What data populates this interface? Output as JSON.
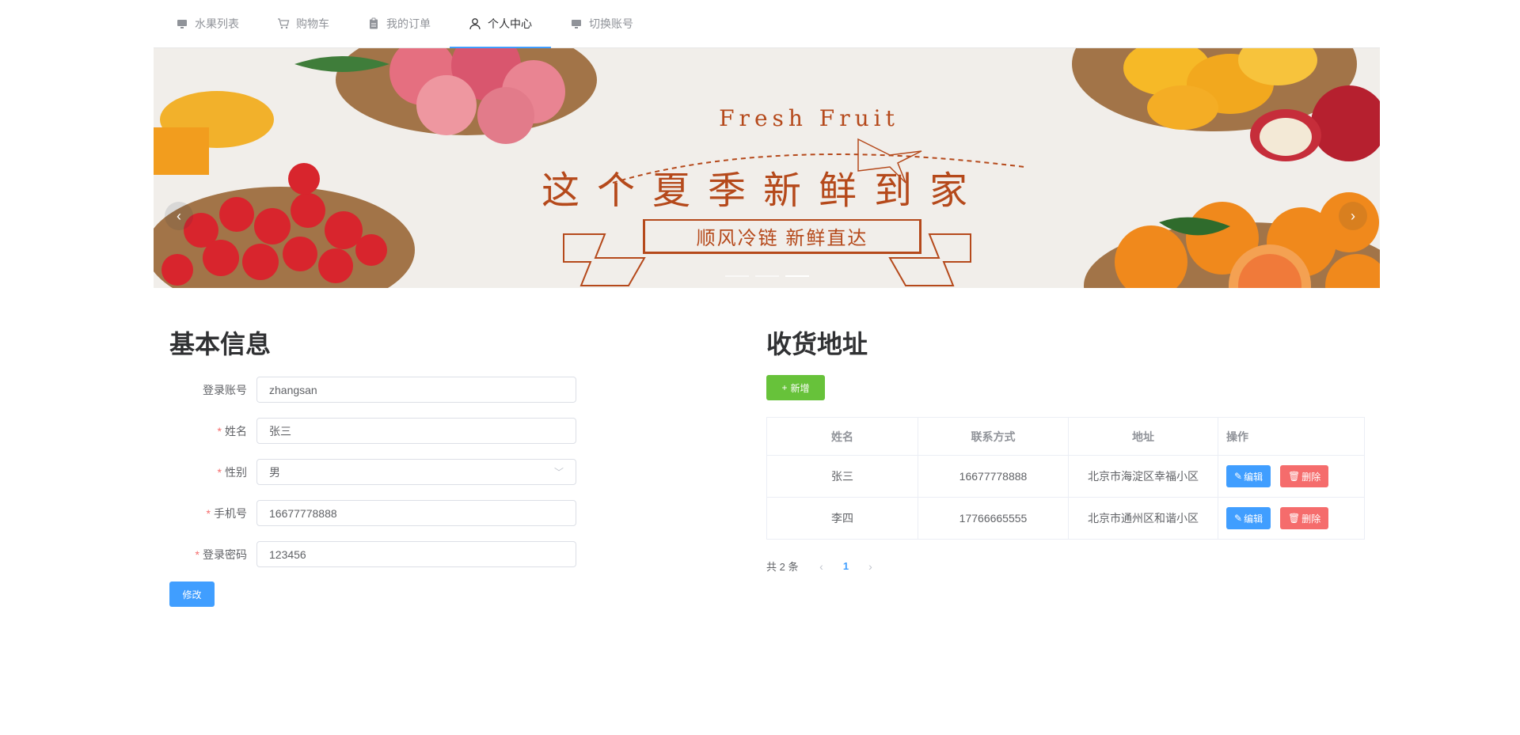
{
  "menu": {
    "items": [
      {
        "label": "水果列表",
        "icon": "monitor-icon"
      },
      {
        "label": "购物车",
        "icon": "cart-icon"
      },
      {
        "label": "我的订单",
        "icon": "clipboard-icon"
      },
      {
        "label": "个人中心",
        "icon": "user-icon",
        "active": true
      },
      {
        "label": "切换账号",
        "icon": "monitor-icon"
      }
    ]
  },
  "banner": {
    "title_en": "Fresh Fruit",
    "title_cn": "这个夏季新鲜到家",
    "subtitle": "顺风冷链 新鲜直达",
    "active_slide": 3,
    "slide_count": 3
  },
  "profile": {
    "title": "基本信息",
    "fields": [
      {
        "label": "登录账号",
        "value": "zhangsan",
        "required": false
      },
      {
        "label": "姓名",
        "value": "张三",
        "required": true
      },
      {
        "label": "性别",
        "value": "男",
        "required": true
      },
      {
        "label": "手机号",
        "value": "16677778888",
        "required": true
      },
      {
        "label": "登录密码",
        "value": "123456",
        "required": true
      }
    ],
    "submit_label": "修改"
  },
  "address": {
    "title": "收货地址",
    "add_label": "新增",
    "columns": [
      "姓名",
      "联系方式",
      "地址",
      "操作"
    ],
    "rows": [
      {
        "name": "张三",
        "phone": "16677778888",
        "address": "北京市海淀区幸福小区"
      },
      {
        "name": "李四",
        "phone": "17766665555",
        "address": "北京市通州区和谐小区"
      }
    ],
    "edit_label": "编辑",
    "delete_label": "删除",
    "pagination": {
      "total_text": "共 2 条",
      "current_page": "1"
    }
  },
  "colors": {
    "primary": "#409eff",
    "success": "#67c23a",
    "danger": "#f56c6c",
    "banner_text": "#b5491b"
  }
}
